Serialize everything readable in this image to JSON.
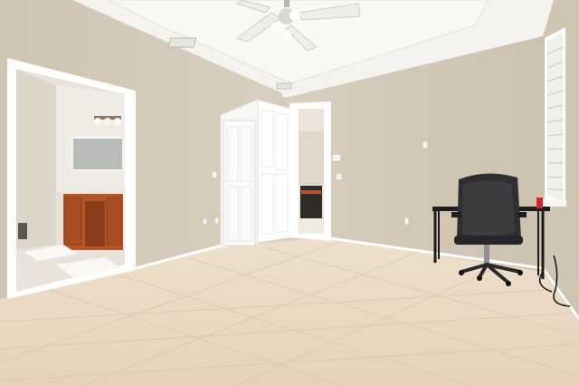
{
  "scene": {
    "room": "empty-bedroom-office",
    "wall_color": "#d3c9b8",
    "ceiling_color": "#f2f1ed",
    "floor_color": "#e9d8c2",
    "trim_color": "#ffffff",
    "vanity_color": "#b5552a"
  },
  "objects": [
    "ceiling-fan-icon",
    "air-vent-icon",
    "tray-ceiling",
    "bathroom-doorway",
    "bathroom-vanity",
    "bathroom-mirror",
    "vanity-lights",
    "closet-door-left",
    "closet-door-right-open",
    "hallway-doorway",
    "kitchen-oven",
    "thermostat-icon",
    "light-switch-icon",
    "electrical-outlet-icon",
    "desk",
    "office-chair",
    "window-blinds",
    "tile-floor"
  ]
}
